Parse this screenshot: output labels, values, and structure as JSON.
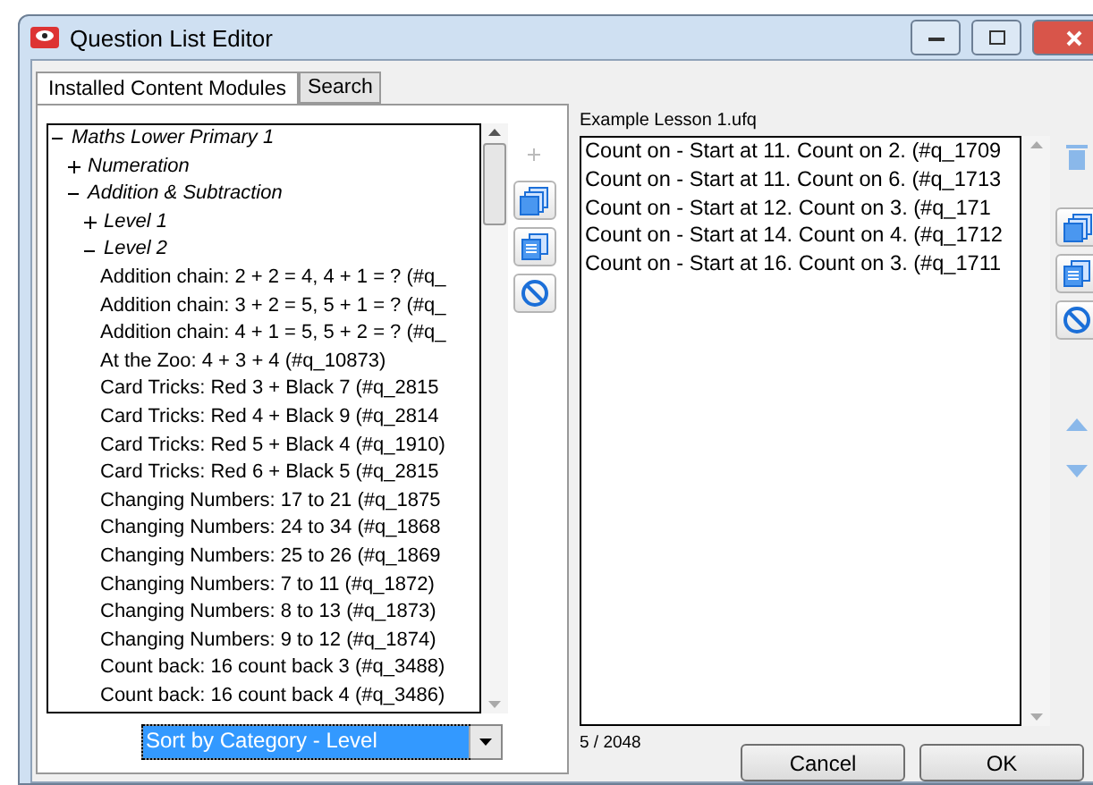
{
  "window": {
    "title": "Question List Editor"
  },
  "tabs": [
    {
      "label": "Installed Content Modules",
      "selected": true
    },
    {
      "label": "Search",
      "selected": false
    }
  ],
  "tree": [
    {
      "label": "Maths Lower Primary 1",
      "expanded": true,
      "children": [
        {
          "label": "Numeration",
          "expanded": false
        },
        {
          "label": "Addition & Subtraction",
          "expanded": true,
          "children": [
            {
              "label": "Level 1",
              "expanded": false
            },
            {
              "label": "Level 2",
              "expanded": true,
              "children": [
                {
                  "label": "Addition chain: 2 + 2 = 4, 4 + 1 = ? (#q_"
                },
                {
                  "label": "Addition chain: 3 + 2 = 5, 5 + 1 = ? (#q_"
                },
                {
                  "label": "Addition chain: 4 + 1 = 5, 5 + 2 = ? (#q_"
                },
                {
                  "label": "At the Zoo: 4 + 3 + 4 (#q_10873)"
                },
                {
                  "label": "Card Tricks: Red 3 + Black 7 (#q_2815"
                },
                {
                  "label": "Card Tricks: Red 4 + Black 9 (#q_2814"
                },
                {
                  "label": "Card Tricks: Red 5 + Black 4 (#q_1910)"
                },
                {
                  "label": "Card Tricks: Red 6 + Black 5 (#q_2815"
                },
                {
                  "label": "Changing Numbers: 17 to 21 (#q_1875"
                },
                {
                  "label": "Changing Numbers: 24 to 34 (#q_1868"
                },
                {
                  "label": "Changing Numbers: 25 to 26 (#q_1869"
                },
                {
                  "label": "Changing Numbers: 7 to 11 (#q_1872)"
                },
                {
                  "label": "Changing Numbers: 8 to 13 (#q_1873)"
                },
                {
                  "label": "Changing Numbers: 9 to 12 (#q_1874)"
                },
                {
                  "label": "Count back: 16 count back 3 (#q_3488)"
                },
                {
                  "label": "Count back: 16 count back 4 (#q_3486)"
                }
              ]
            }
          ]
        }
      ]
    }
  ],
  "sort_dropdown": {
    "value": "Sort by Category - Level"
  },
  "lesson": {
    "title": "Example Lesson 1.ufq",
    "items": [
      "Count on - Start at 11. Count on 2. (#q_1709",
      "Count on - Start at 11. Count on 6. (#q_1713",
      "Count on - Start at 12. Count on 3.  (#q_171",
      "Count on - Start at 14. Count on 4. (#q_1712",
      "Count on - Start at 16. Count on 3. (#q_1711"
    ],
    "count": "5 / 2048"
  },
  "buttons": [
    "Cancel",
    "OK"
  ]
}
